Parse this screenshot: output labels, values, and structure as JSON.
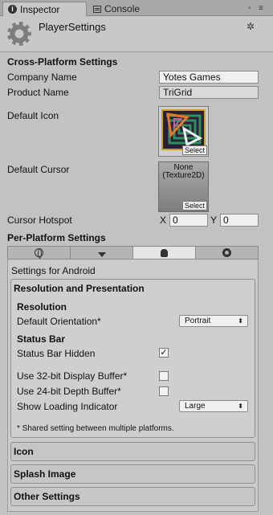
{
  "tabs": {
    "inspector": "Inspector",
    "console": "Console"
  },
  "header": {
    "title": "PlayerSettings",
    "gear_glyph": "✲"
  },
  "cross_platform": {
    "title": "Cross-Platform Settings",
    "company_label": "Company Name",
    "company_value": "Yotes Games",
    "product_label": "Product Name",
    "product_value": "TriGrid",
    "icon_label": "Default Icon",
    "icon_select": "Select",
    "cursor_label": "Default Cursor",
    "cursor_value_line1": "None",
    "cursor_value_line2": "(Texture2D)",
    "cursor_select": "Select",
    "hotspot_label": "Cursor Hotspot",
    "hotspot_x_label": "X",
    "hotspot_x_value": "0",
    "hotspot_y_label": "Y",
    "hotspot_y_value": "0"
  },
  "per_platform": {
    "title": "Per-Platform Settings",
    "platform_icons": [
      "globe-icon",
      "download-icon",
      "android-icon",
      "circle-icon"
    ],
    "active_platform_index": 2,
    "settings_for": "Settings for Android"
  },
  "resolution": {
    "title": "Resolution and Presentation",
    "subtitle_resolution": "Resolution",
    "orientation_label": "Default Orientation*",
    "orientation_value": "Portrait",
    "subtitle_statusbar": "Status Bar",
    "status_hidden_label": "Status Bar Hidden",
    "status_hidden_checked": true,
    "buffer32_label": "Use 32-bit Display Buffer*",
    "buffer32_checked": false,
    "depth24_label": "Use 24-bit Depth Buffer*",
    "depth24_checked": false,
    "loading_label": "Show Loading Indicator",
    "loading_value": "Large",
    "note": "* Shared setting between multiple platforms."
  },
  "sections": {
    "icon": "Icon",
    "splash": "Splash Image",
    "other": "Other Settings"
  },
  "checkmark": "✓",
  "dropdown_arrow": "⬍",
  "colors": {
    "background": "#c2c2c2",
    "field": "#f0f0f0",
    "active_tab": "#e6e6e6"
  }
}
